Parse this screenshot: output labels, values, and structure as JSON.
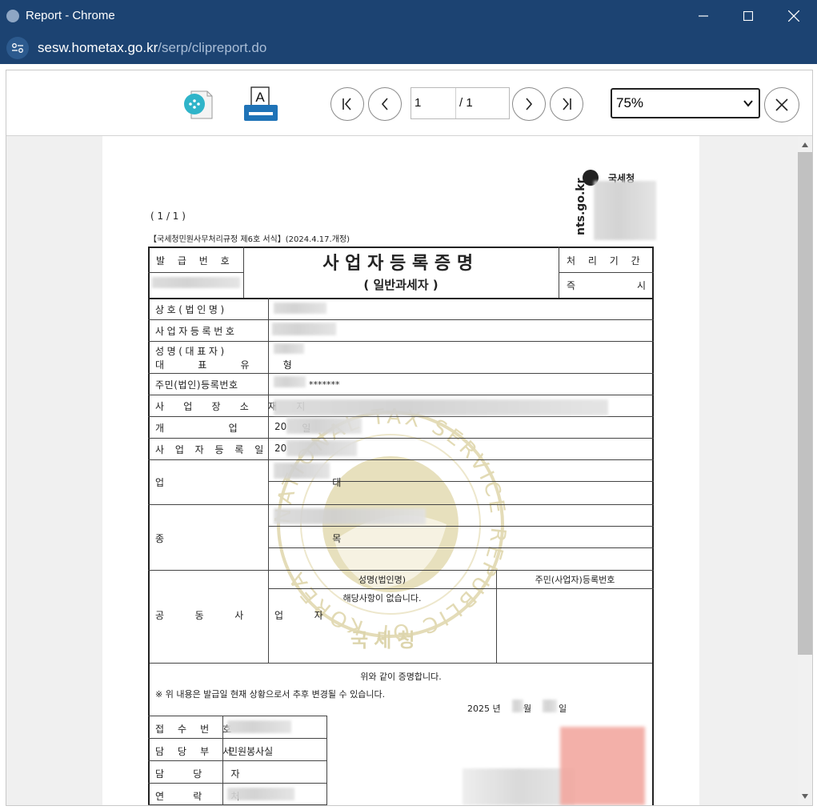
{
  "window": {
    "title": "Report - Chrome",
    "url_host": "sesw.hometax.go.kr",
    "url_path": "/serp/clipreport.do"
  },
  "toolbar": {
    "current_page": "1",
    "total_pages": "/ 1",
    "zoom": "75%"
  },
  "document": {
    "page_indicator": "(   1 / 1   )",
    "form_reference": "【국세청민원사무처리규정 제6호 서식】(2024.4.17.개정)",
    "agency_name": "국세청",
    "agency_site": "nts.go.kr",
    "issue_no_label": "발 급 번 호",
    "title": "사업자등록증명",
    "subtitle": "( 일반과세자 )",
    "processing_label": "처 리 기 간",
    "processing_value_left": "즉",
    "processing_value_right": "시",
    "fields": {
      "trade_name": "상호(법인명)",
      "business_reg_no": "사업자등록번호",
      "name_rep": "성명(대표자)",
      "rep_type": "대 표 유 형",
      "resident_no": "주민(법인)등록번호",
      "resident_no_mask": "*******",
      "address": "사 업 장 소 재 지",
      "opening_date": "개 업 일",
      "opening_date_prefix": "20",
      "reg_date": "사업자등록일",
      "reg_date_prefix": "20",
      "business_type": "업 태",
      "business_item": "종 목",
      "co_business": "공 동 사 업 자",
      "co_name_header": "성명(법인명)",
      "co_id_header": "주민(사업자)등록번호",
      "co_none": "해당사항이 없습니다."
    },
    "certify_text": "위와 같이 증명합니다.",
    "note_text": "※  위 내용은 발급일 현재 상황으로서 추후 변경될 수 있습니다.",
    "date_year": "2025 년",
    "date_month": "월",
    "date_day": "일",
    "receipt": {
      "receipt_no": "접 수 번 호",
      "dept": "담 당 부 서",
      "dept_value": "민원봉사실",
      "officer": "담 당 자",
      "contact": "연 락 처"
    },
    "seal_text": "국세청",
    "seal_ring_text": "NATIONAL TAX SERVICE REPUBLIC OF KOREA"
  },
  "colors": {
    "title_bar": "#1c4372",
    "seal": "#e4dcb8",
    "stamp": "#f2a8a0"
  }
}
